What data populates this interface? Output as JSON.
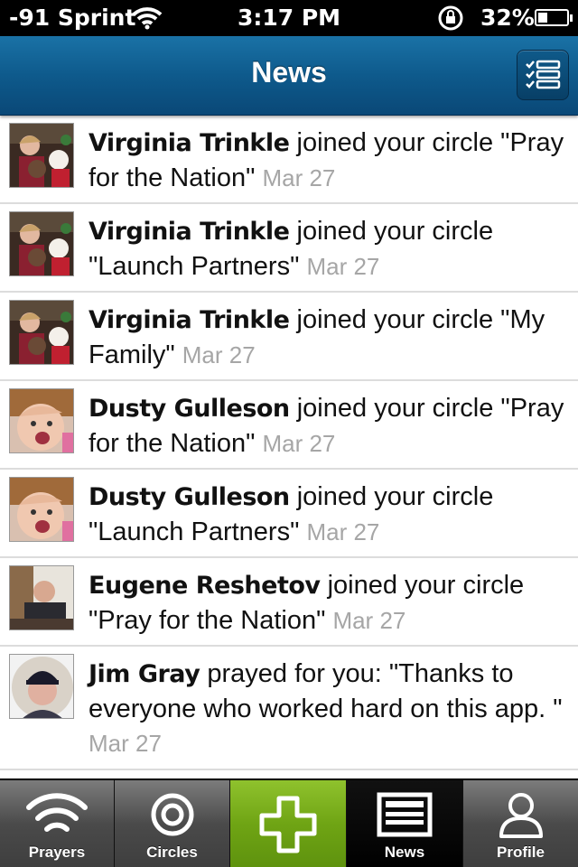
{
  "status": {
    "carrier": "-91 Sprint",
    "time": "3:17 PM",
    "battery": "32%",
    "battery_level": 0.32
  },
  "nav": {
    "title": "News"
  },
  "feed": [
    {
      "name": "Virginia Trinkle",
      "action": "joined your circle",
      "detail": "\"Pray for the Nation\"",
      "date": "Mar 27"
    },
    {
      "name": "Virginia Trinkle",
      "action": "joined your circle",
      "detail": "\"Launch Partners\"",
      "date": "Mar 27"
    },
    {
      "name": "Virginia Trinkle",
      "action": "joined your circle",
      "detail": "\"My Family\"",
      "date": "Mar 27"
    },
    {
      "name": "Dusty Gulleson",
      "action": "joined your circle",
      "detail": "\"Pray for the Nation\"",
      "date": "Mar 27"
    },
    {
      "name": "Dusty Gulleson",
      "action": "joined your circle",
      "detail": "\"Launch Partners\"",
      "date": "Mar 27"
    },
    {
      "name": "Eugene Reshetov",
      "action": "joined your circle",
      "detail": "\"Pray for the Nation\"",
      "date": "Mar 27"
    },
    {
      "name": "Jim Gray",
      "action": "prayed for you:",
      "detail": "\"Thanks to everyone who worked hard on this app. \"",
      "date": "Mar 27"
    }
  ],
  "tabs": [
    {
      "label": "Prayers",
      "icon": "wifi-waves-icon"
    },
    {
      "label": "Circles",
      "icon": "target-icon"
    },
    {
      "label": "",
      "icon": "plus-icon"
    },
    {
      "label": "News",
      "icon": "newspaper-icon"
    },
    {
      "label": "Profile",
      "icon": "person-icon"
    }
  ],
  "colors": {
    "nav": "#0e5a8c",
    "add_tab": "#7ab51e",
    "date": "#a6a6a6"
  }
}
